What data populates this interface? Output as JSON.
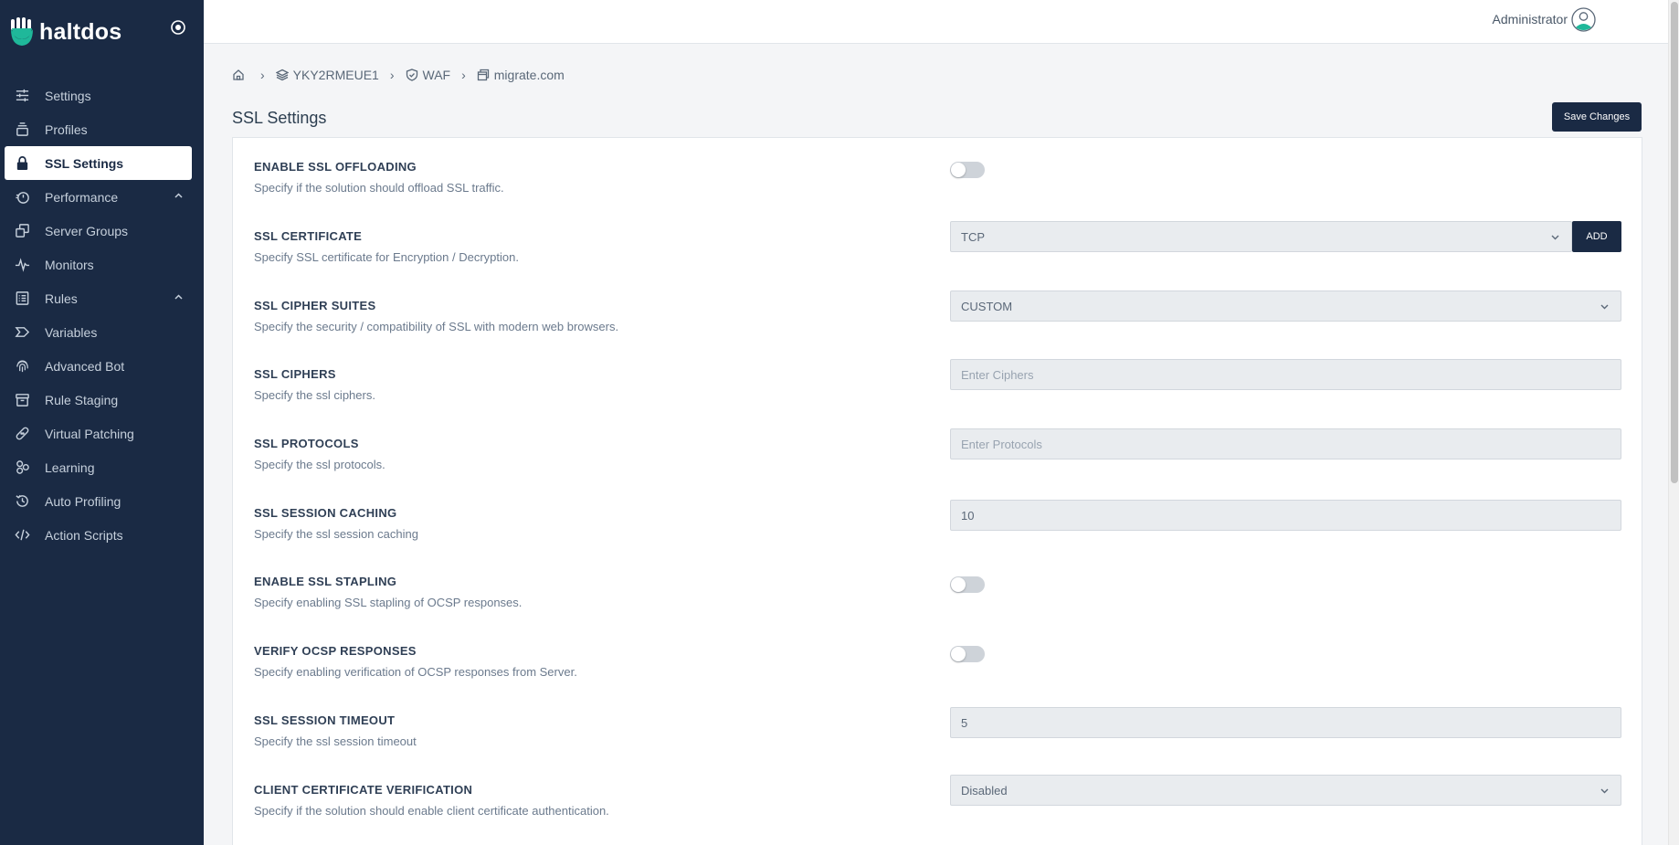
{
  "brand": {
    "name": "haltdos"
  },
  "sidebar": {
    "items": [
      {
        "label": "Settings",
        "icon": "sliders-icon"
      },
      {
        "label": "Profiles",
        "icon": "stack-icon"
      },
      {
        "label": "SSL Settings",
        "icon": "lock-icon",
        "active": true
      },
      {
        "label": "Performance",
        "icon": "stopwatch-icon",
        "expandable": true
      },
      {
        "label": "Server Groups",
        "icon": "server-groups-icon"
      },
      {
        "label": "Monitors",
        "icon": "pulse-icon"
      },
      {
        "label": "Rules",
        "icon": "list-icon",
        "expandable": true
      },
      {
        "label": "Variables",
        "icon": "tag-icon"
      },
      {
        "label": "Advanced Bot",
        "icon": "fingerprint-icon"
      },
      {
        "label": "Rule Staging",
        "icon": "archive-icon"
      },
      {
        "label": "Virtual Patching",
        "icon": "bandage-icon"
      },
      {
        "label": "Learning",
        "icon": "nodes-icon"
      },
      {
        "label": "Auto Profiling",
        "icon": "history-icon"
      },
      {
        "label": "Action Scripts",
        "icon": "code-icon"
      }
    ]
  },
  "topbar": {
    "user": "Administrator"
  },
  "breadcrumb": [
    {
      "label": "",
      "icon": "home-icon"
    },
    {
      "label": "YKY2RMEUE1",
      "icon": "layers-icon"
    },
    {
      "label": "WAF",
      "icon": "shield-icon"
    },
    {
      "label": "migrate.com",
      "icon": "window-icon"
    }
  ],
  "page": {
    "title": "SSL Settings",
    "save_label": "Save Changes"
  },
  "settings": [
    {
      "label": "ENABLE SSL OFFLOADING",
      "desc": "Specify if the solution should offload SSL traffic.",
      "control": "toggle",
      "on": false
    },
    {
      "label": "SSL CERTIFICATE",
      "desc": "Specify SSL certificate for Encryption / Decryption.",
      "control": "select-add",
      "value": "TCP",
      "add_label": "ADD"
    },
    {
      "label": "SSL CIPHER SUITES",
      "desc": "Specify the security / compatibility of SSL with modern web browsers.",
      "control": "select",
      "value": "CUSTOM"
    },
    {
      "label": "SSL CIPHERS",
      "desc": "Specify the ssl ciphers.",
      "control": "input",
      "value": "",
      "placeholder": "Enter Ciphers"
    },
    {
      "label": "SSL PROTOCOLS",
      "desc": "Specify the ssl protocols.",
      "control": "input",
      "value": "",
      "placeholder": "Enter Protocols"
    },
    {
      "label": "SSL SESSION CACHING",
      "desc": "Specify the ssl session caching",
      "control": "input",
      "value": "10"
    },
    {
      "label": "ENABLE SSL STAPLING",
      "desc": "Specify enabling SSL stapling of OCSP responses.",
      "control": "toggle",
      "on": false
    },
    {
      "label": "VERIFY OCSP RESPONSES",
      "desc": "Specify enabling verification of OCSP responses from Server.",
      "control": "toggle",
      "on": false
    },
    {
      "label": "SSL SESSION TIMEOUT",
      "desc": "Specify the ssl session timeout",
      "control": "input",
      "value": "5"
    },
    {
      "label": "CLIENT CERTIFICATE VERIFICATION",
      "desc": "Specify if the solution should enable client certificate authentication.",
      "control": "select",
      "value": "Disabled"
    }
  ],
  "colors": {
    "sidebar_bg": "#1a2a44",
    "accent": "#1a2a44",
    "brand_teal": "#1fb89a"
  }
}
